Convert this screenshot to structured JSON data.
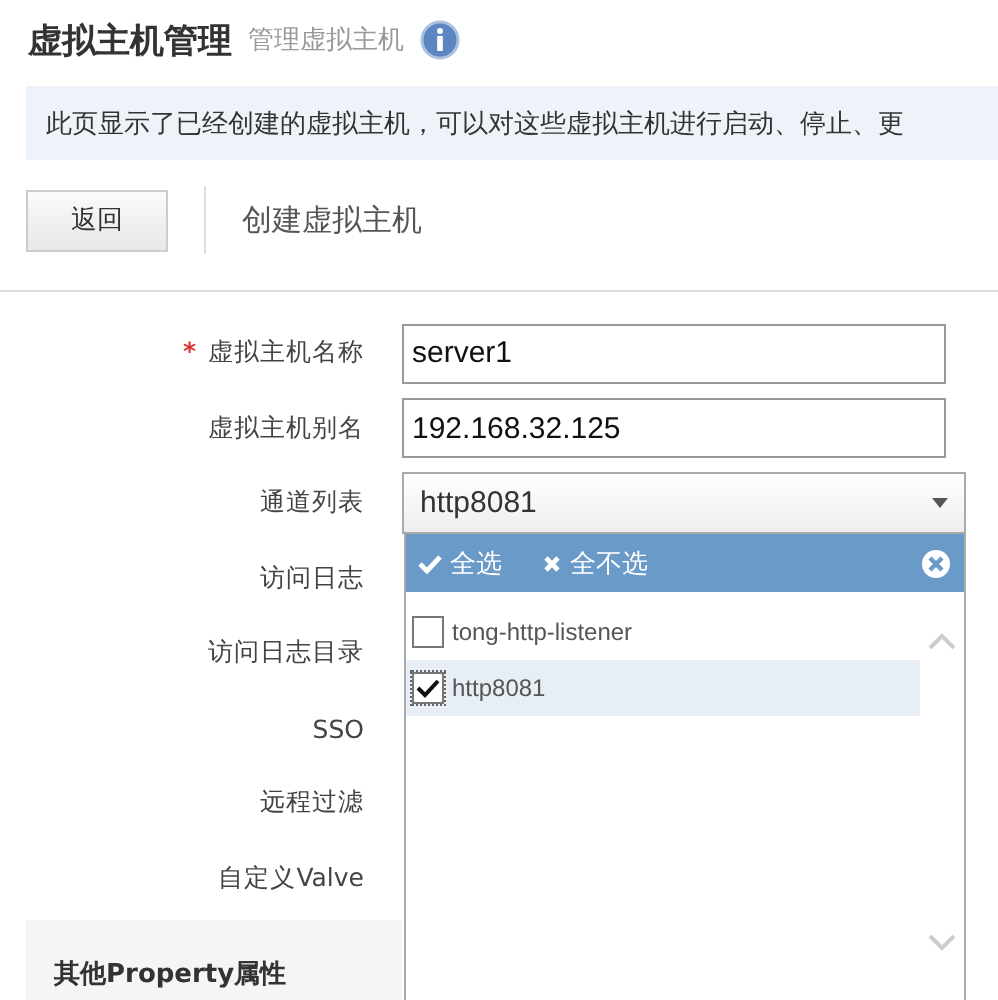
{
  "header": {
    "title": "虚拟主机管理",
    "subtitle": "管理虚拟主机"
  },
  "info_bar": "此页显示了已经创建的虚拟主机，可以对这些虚拟主机进行启动、停止、更",
  "toolbar": {
    "back_button": "返回",
    "heading": "创建虚拟主机"
  },
  "form": [
    {
      "label": "虚拟主机名称",
      "required": true,
      "kind": "input",
      "value": "server1"
    },
    {
      "label": "虚拟主机别名",
      "required": false,
      "kind": "input",
      "value": "192.168.32.125"
    },
    {
      "label": "通道列表",
      "required": false,
      "kind": "select",
      "value": "http8081",
      "expanded": true,
      "dropdown": {
        "select_all": "全选",
        "select_none": "全不选",
        "options": [
          {
            "label": "tong-http-listener",
            "checked": false,
            "selected": false
          },
          {
            "label": "http8081",
            "checked": true,
            "selected": true
          }
        ]
      }
    },
    {
      "label": "访问日志",
      "required": false,
      "kind": "covered"
    },
    {
      "label": "访问日志目录",
      "required": false,
      "kind": "covered"
    },
    {
      "label": "SSO",
      "required": false,
      "kind": "covered"
    },
    {
      "label": "远程过滤",
      "required": false,
      "kind": "covered"
    },
    {
      "label": "自定义Valve",
      "required": false,
      "kind": "covered"
    }
  ],
  "section_heading": "其他Property属性",
  "required_mark": "*"
}
